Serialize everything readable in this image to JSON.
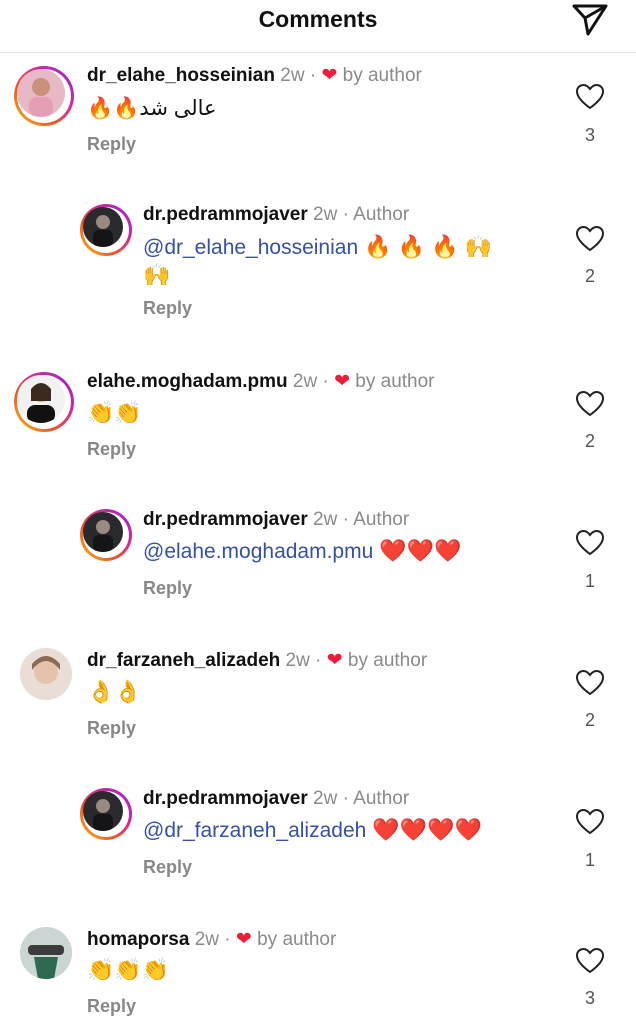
{
  "header": {
    "title": "Comments"
  },
  "comments": [
    {
      "user": "dr_elahe_hosseinian",
      "time": "2w",
      "badge": "by author",
      "text": "عالی شد🔥🔥",
      "reply": "Reply",
      "likes": "3"
    },
    {
      "user": "dr.pedrammojaver",
      "time": "2w",
      "badge": "Author",
      "mention": "@dr_elahe_hosseinian",
      "emojis": " 🔥 🔥 🔥 🙌",
      "text2": "🙌",
      "reply": "Reply",
      "likes": "2"
    },
    {
      "user": "elahe.moghadam.pmu",
      "time": "2w",
      "badge": "by author",
      "text": "👏👏",
      "reply": "Reply",
      "likes": "2"
    },
    {
      "user": "dr.pedrammojaver",
      "time": "2w",
      "badge": "Author",
      "mention": "@elahe.moghadam.pmu",
      "emojis": " ❤️❤️❤️",
      "reply": "Reply",
      "likes": "1"
    },
    {
      "user": "dr_farzaneh_alizadeh",
      "time": "2w",
      "badge": "by author",
      "text": "👌👌",
      "reply": "Reply",
      "likes": "2"
    },
    {
      "user": "dr.pedrammojaver",
      "time": "2w",
      "badge": "Author",
      "mention": "@dr_farzaneh_alizadeh",
      "emojis": " ❤️❤️❤️❤️",
      "reply": "Reply",
      "likes": "1"
    },
    {
      "user": "homaporsa",
      "time": "2w",
      "badge": "by author",
      "text": "👏👏👏",
      "reply": "Reply",
      "likes": "3"
    }
  ],
  "separator": "·"
}
